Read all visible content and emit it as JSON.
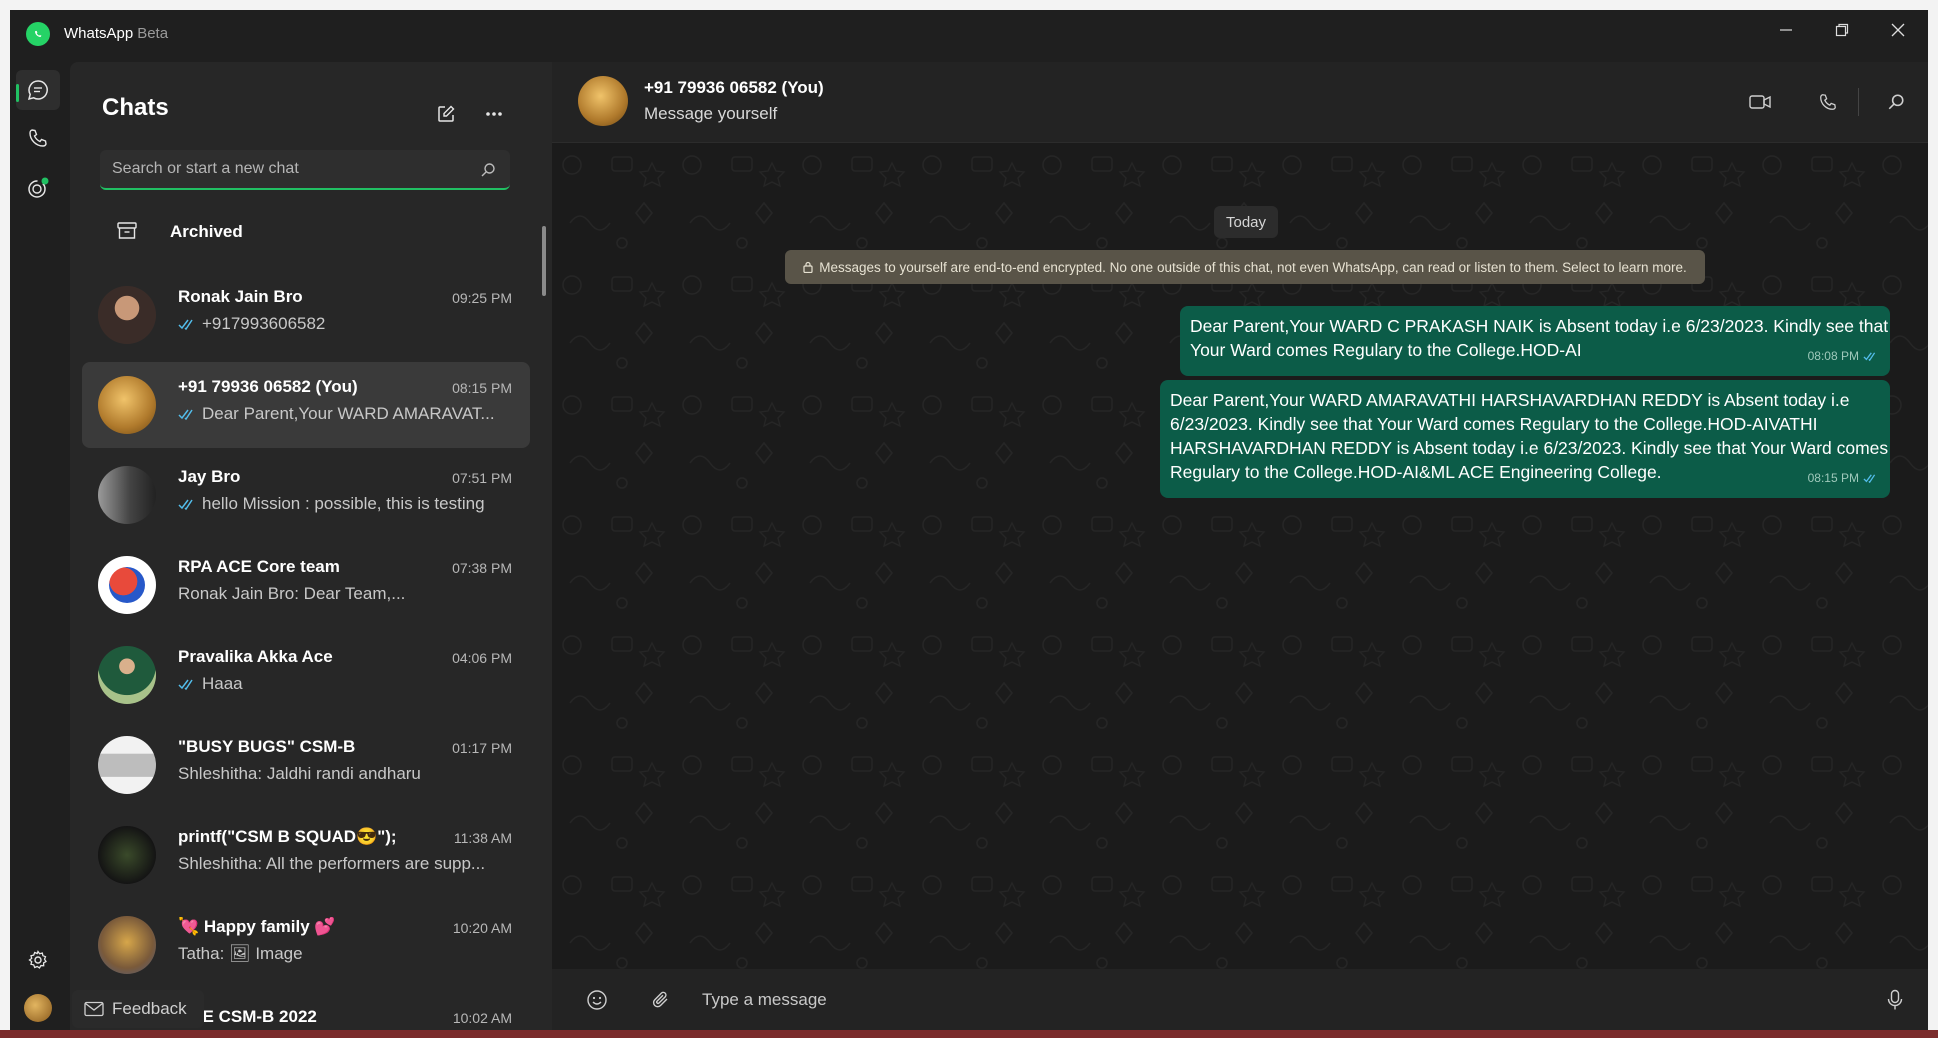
{
  "window": {
    "app_name": "WhatsApp",
    "app_badge": "Beta",
    "controls": [
      "minimize-icon",
      "restore-icon",
      "close-icon"
    ]
  },
  "rail": {
    "items": [
      {
        "name": "chats",
        "icon": "chat-icon",
        "active": true
      },
      {
        "name": "calls",
        "icon": "phone-icon"
      },
      {
        "name": "status",
        "icon": "status-icon"
      }
    ],
    "bottom": [
      {
        "name": "settings",
        "icon": "gear-icon"
      },
      {
        "name": "profile",
        "icon": "avatar"
      }
    ]
  },
  "sidebar": {
    "title": "Chats",
    "search_placeholder": "Search or start a new chat",
    "archived_label": "Archived",
    "chats": [
      {
        "name": "Ronak Jain Bro",
        "time": "09:25 PM",
        "preview": "+917993606582",
        "ticks": true
      },
      {
        "name": "+91 79936 06582 (You)",
        "time": "08:15 PM",
        "preview": "Dear Parent,Your WARD AMARAVAT...",
        "ticks": true,
        "active": true
      },
      {
        "name": "Jay Bro",
        "time": "07:51 PM",
        "preview": "hello Mission : possible, this is testing",
        "ticks": true
      },
      {
        "name": "RPA ACE Core team",
        "time": "07:38 PM",
        "preview": "Ronak Jain Bro: Dear Team,..."
      },
      {
        "name": "Pravalika Akka Ace",
        "time": "04:06 PM",
        "preview": "Haaa",
        "ticks": true
      },
      {
        "name": "\"BUSY BUGS\" CSM-B",
        "time": "01:17 PM",
        "preview": "Shleshitha: Jaldhi randi andharu"
      },
      {
        "name": "printf(\"CSM B SQUAD😎\");",
        "time": "11:38 AM",
        "preview": "Shleshitha: All the performers are supp..."
      },
      {
        "name": "💘 Happy family 💕",
        "time": "10:20 AM",
        "preview": "Tatha: 🖼 Image"
      },
      {
        "name": "ACE CSM-B 2022",
        "time": "10:02 AM",
        "preview": ""
      }
    ],
    "feedback_label": "Feedback"
  },
  "conversation": {
    "name": "+91 79936 06582 (You)",
    "subtitle": "Message yourself",
    "date_chip": "Today",
    "encryption_notice": "Messages to yourself are end-to-end encrypted. No one outside of this chat, not even WhatsApp, can read or listen to them. Select to learn more.",
    "messages": [
      {
        "lines": [
          "Dear Parent,Your WARD C PRAKASH NAIK is Absent today i.e 6/23/2023. Kindly see that",
          "Your Ward comes Regulary to the College.HOD-AI"
        ],
        "time": "08:08 PM"
      },
      {
        "lines": [
          "Dear Parent,Your WARD AMARAVATHI HARSHAVARDHAN REDDY is Absent today i.e",
          "6/23/2023. Kindly see that Your Ward comes Regulary to the College.HOD-AIVATHI",
          "HARSHAVARDHAN REDDY is Absent today i.e 6/23/2023. Kindly see that Your Ward comes",
          "Regulary to the College.HOD-AI&ML  ACE Engineering College."
        ],
        "time": "08:15 PM"
      }
    ],
    "composer_placeholder": "Type a message"
  },
  "colors": {
    "accent": "#21c063",
    "bubble": "#0c5c48",
    "read_tick": "#53bdeb"
  }
}
